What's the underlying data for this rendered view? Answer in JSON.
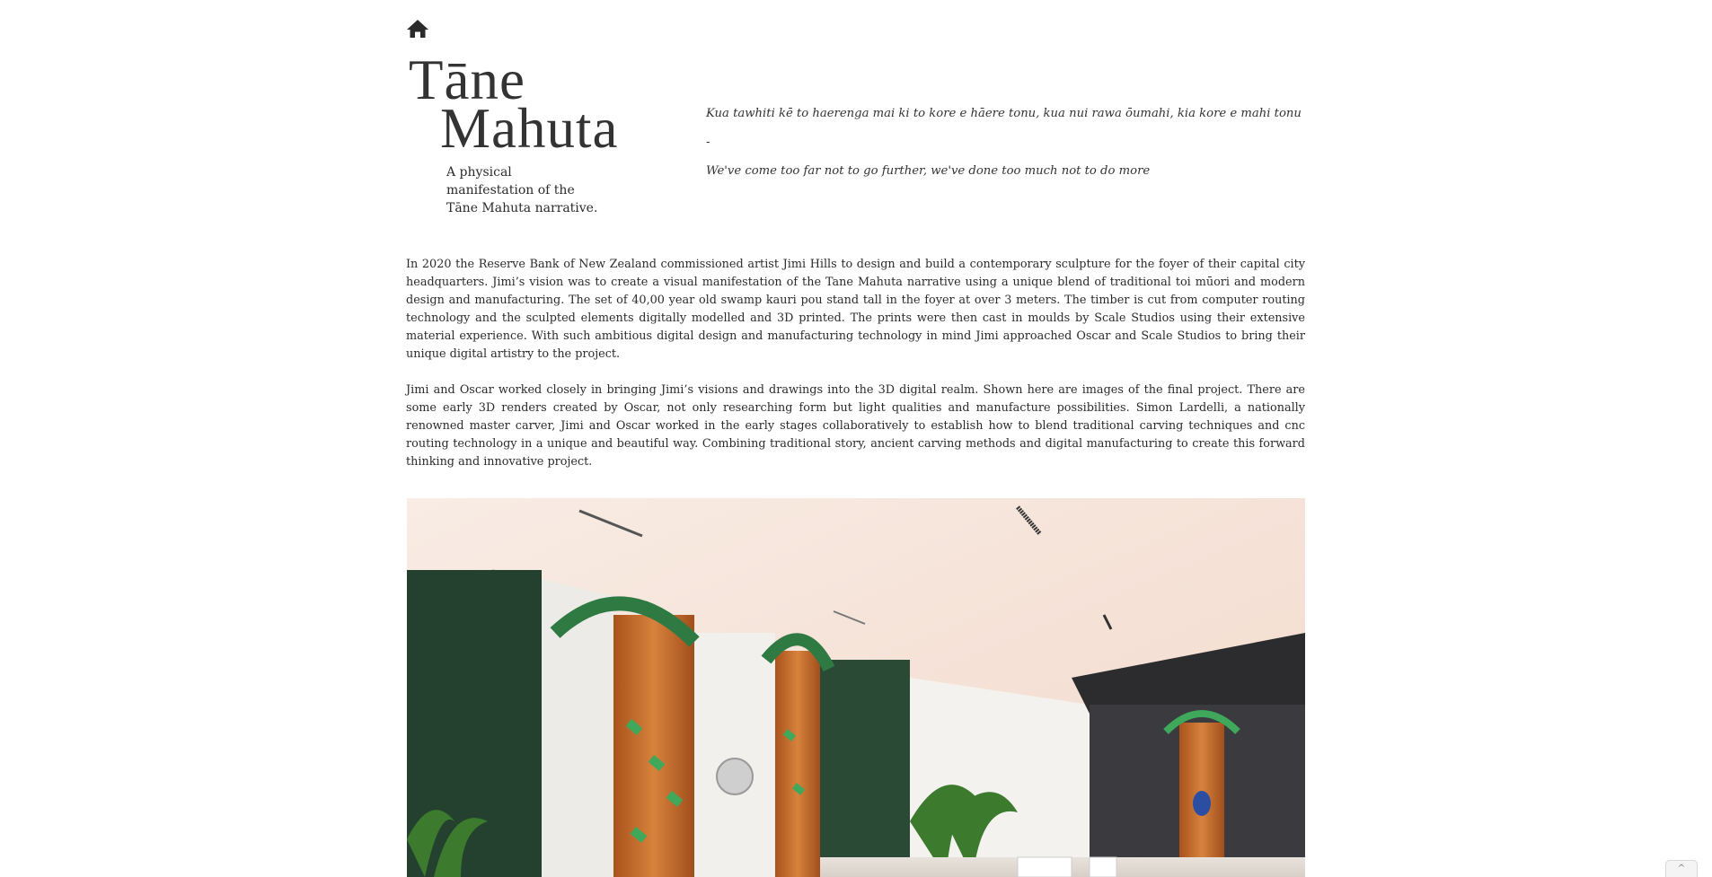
{
  "nav": {
    "home_icon": "home-icon"
  },
  "header": {
    "title_line1": "Tāne",
    "title_line2": "Mahuta",
    "subtitle": "A physical manifestation of the Tāne Mahuta narrative."
  },
  "quote": {
    "maori": "Kua tawhiti kē to haerenga mai ki to kore e hāere tonu, kua nui rawa ōumahi, kia kore e mahi tonu",
    "separator": "-",
    "english": "We've come too far not to go further, we've done too much not to do more"
  },
  "body": {
    "paragraph1": "In 2020 the Reserve Bank of New Zealand commissioned artist Jimi Hills to design and build a  contemporary sculpture for the foyer of their capital city headquarters. Jimi’s vision was to create a visual manifestation of the Tane Mahuta narrative using a unique blend of traditional toi mūori and modern design and manufacturing. The set of 40,00 year old swamp kauri pou stand tall in the foyer at over 3 meters. The timber is cut from computer routing technology and the sculpted  elements digitally modelled and 3D printed. The prints were then cast in moulds by Scale Studios using their extensive material experience. With such ambitious digital design and manufacturing technology in mind Jimi approached Oscar and Scale Studios to bring their unique digital artistry to the project.",
    "paragraph2": "Jimi and Oscar worked closely in bringing Jimi’s visions and drawings into the 3D digital realm. Shown here are images of the final project. There are  some early 3D renders created by Oscar, not only researching form but light qualities and manufacture possibilities. Simon Lardelli, a nationally  renowned master carver,  Jimi and Oscar worked in the early stages collaboratively to establish how to blend traditional carving techniques and cnc routing technology in a unique and beautiful way. Combining traditional story, ancient carving methods and digital manufacturing to create this forward thinking and innovative project."
  },
  "colors": {
    "text": "#2b2b2b",
    "wall_green": "#2a4a36",
    "kauri_wood": "#c46a2a",
    "ceiling": "#f6e4da",
    "glass_green": "#3fa85a"
  },
  "scroll_button": {
    "icon": "chevron-up-icon",
    "glyph": "^"
  }
}
